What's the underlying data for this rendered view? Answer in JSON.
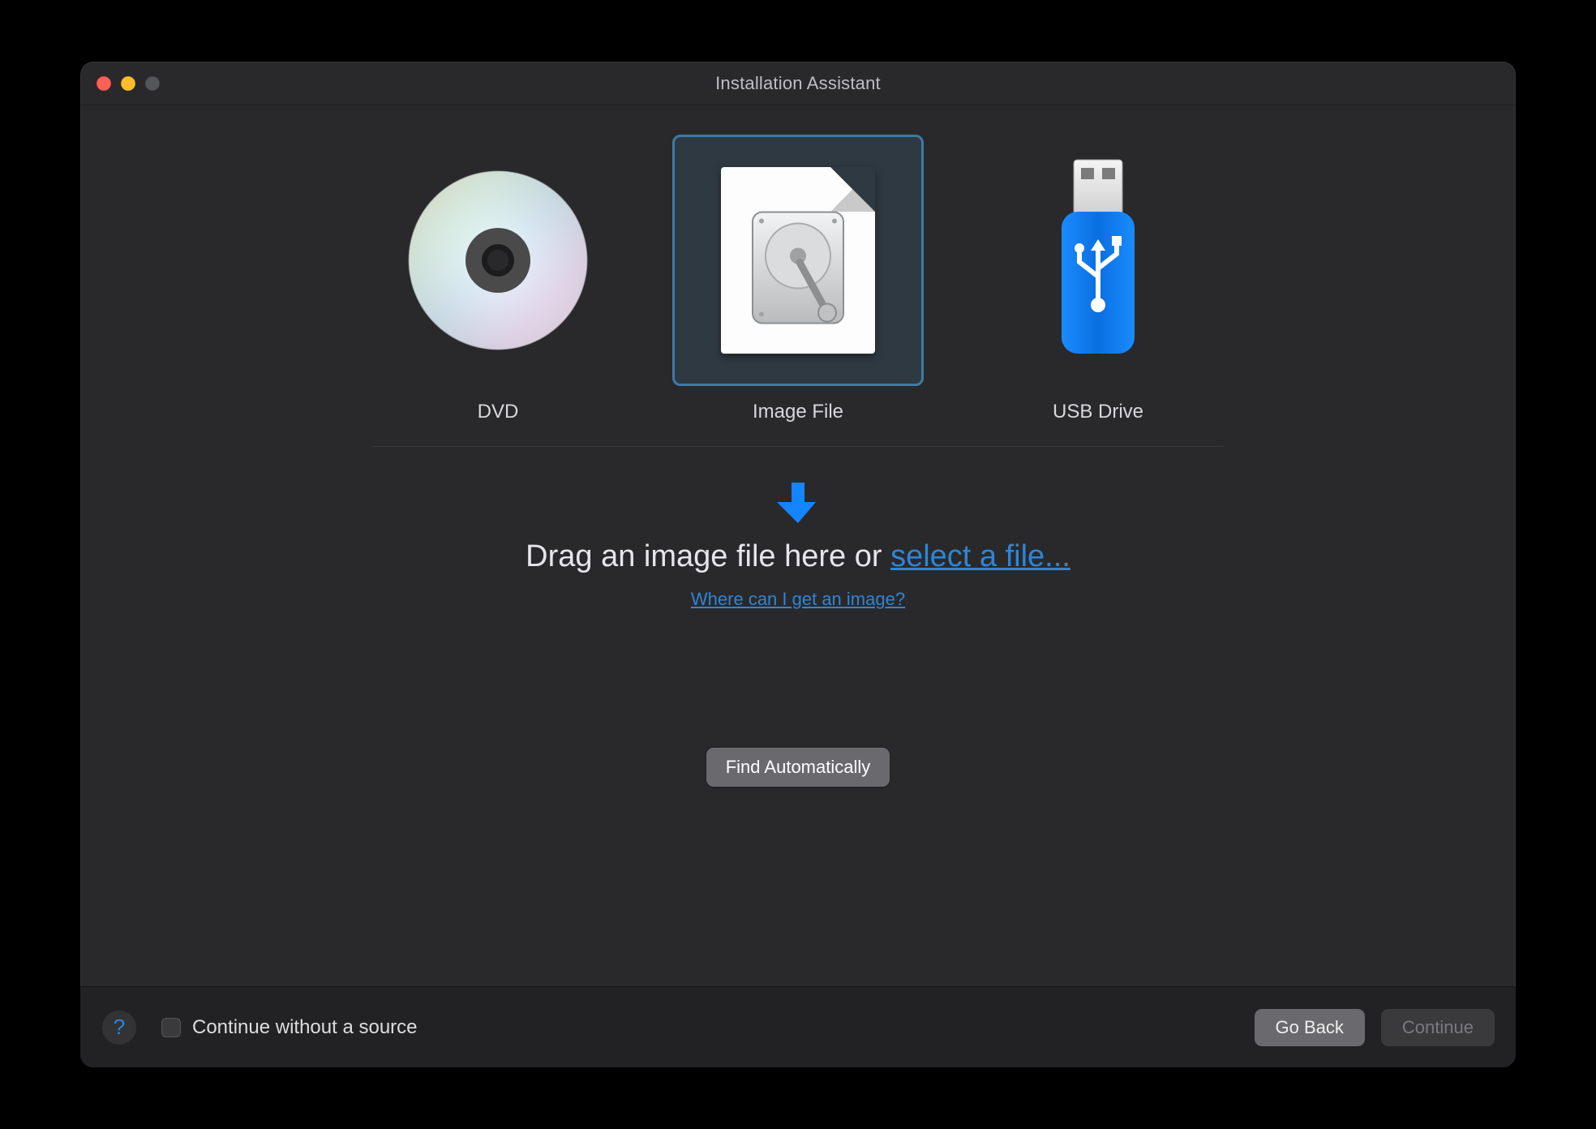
{
  "window": {
    "title": "Installation Assistant"
  },
  "sources": {
    "dvd": {
      "label": "DVD"
    },
    "image": {
      "label": "Image File",
      "selected": true
    },
    "usb": {
      "label": "USB Drive"
    }
  },
  "prompt": {
    "drag_text_prefix": "Drag an image file here or ",
    "select_link": "select a file...",
    "where_link": "Where can I get an image?"
  },
  "buttons": {
    "find_auto": "Find Automatically",
    "go_back": "Go Back",
    "continue": "Continue"
  },
  "footer": {
    "continue_without_source": "Continue without a source",
    "continue_enabled": false
  }
}
